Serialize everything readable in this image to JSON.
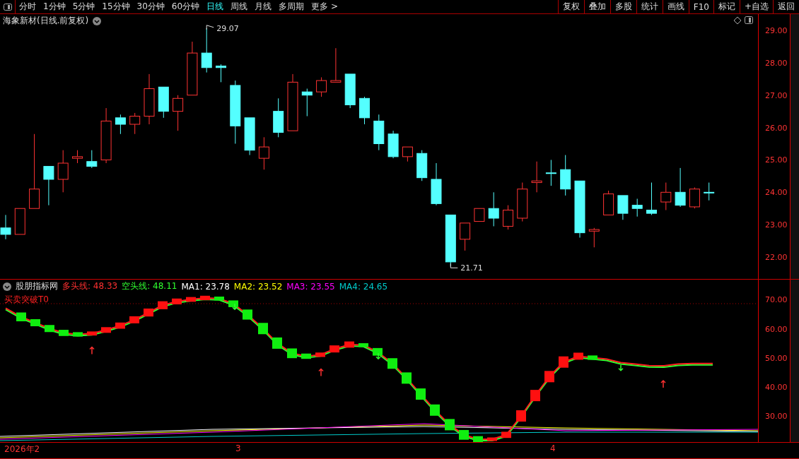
{
  "toolbar": {
    "periods": [
      {
        "label": "分时",
        "selected": false
      },
      {
        "label": "1分钟",
        "selected": false
      },
      {
        "label": "5分钟",
        "selected": false
      },
      {
        "label": "15分钟",
        "selected": false
      },
      {
        "label": "30分钟",
        "selected": false
      },
      {
        "label": "60分钟",
        "selected": false
      },
      {
        "label": "日线",
        "selected": true
      },
      {
        "label": "周线",
        "selected": false
      },
      {
        "label": "月线",
        "selected": false
      },
      {
        "label": "多周期",
        "selected": false
      },
      {
        "label": "更多 >",
        "selected": false
      }
    ],
    "buttons": [
      "复权",
      "叠加",
      "多股",
      "统计",
      "画线",
      "F10",
      "标记",
      "+自选",
      "返回"
    ]
  },
  "main_chart": {
    "title": "海象新材(日线.前复权)",
    "high_label": "29.07",
    "low_label": "21.71",
    "price_axis": [
      "29.00",
      "28.00",
      "27.00",
      "26.00",
      "25.00",
      "24.00",
      "23.00",
      "22.00"
    ]
  },
  "indicator": {
    "name": "股朋指标网",
    "legend": [
      {
        "text": "多头线: 48.33",
        "color": "#ff3030"
      },
      {
        "text": "空头线: 48.11",
        "color": "#30ff30"
      },
      {
        "text": "MA1: 23.78",
        "color": "#ffffff"
      },
      {
        "text": "MA2: 23.52",
        "color": "#ffff00"
      },
      {
        "text": "MA3: 23.55",
        "color": "#ff00ff"
      },
      {
        "text": "MA4: 24.65",
        "color": "#00cccc"
      }
    ],
    "signal_label": "买卖突破T0",
    "axis": [
      "70.00",
      "60.00",
      "50.00",
      "40.00",
      "30.00"
    ]
  },
  "date_axis": [
    "2026年2",
    "3",
    "4"
  ]
}
